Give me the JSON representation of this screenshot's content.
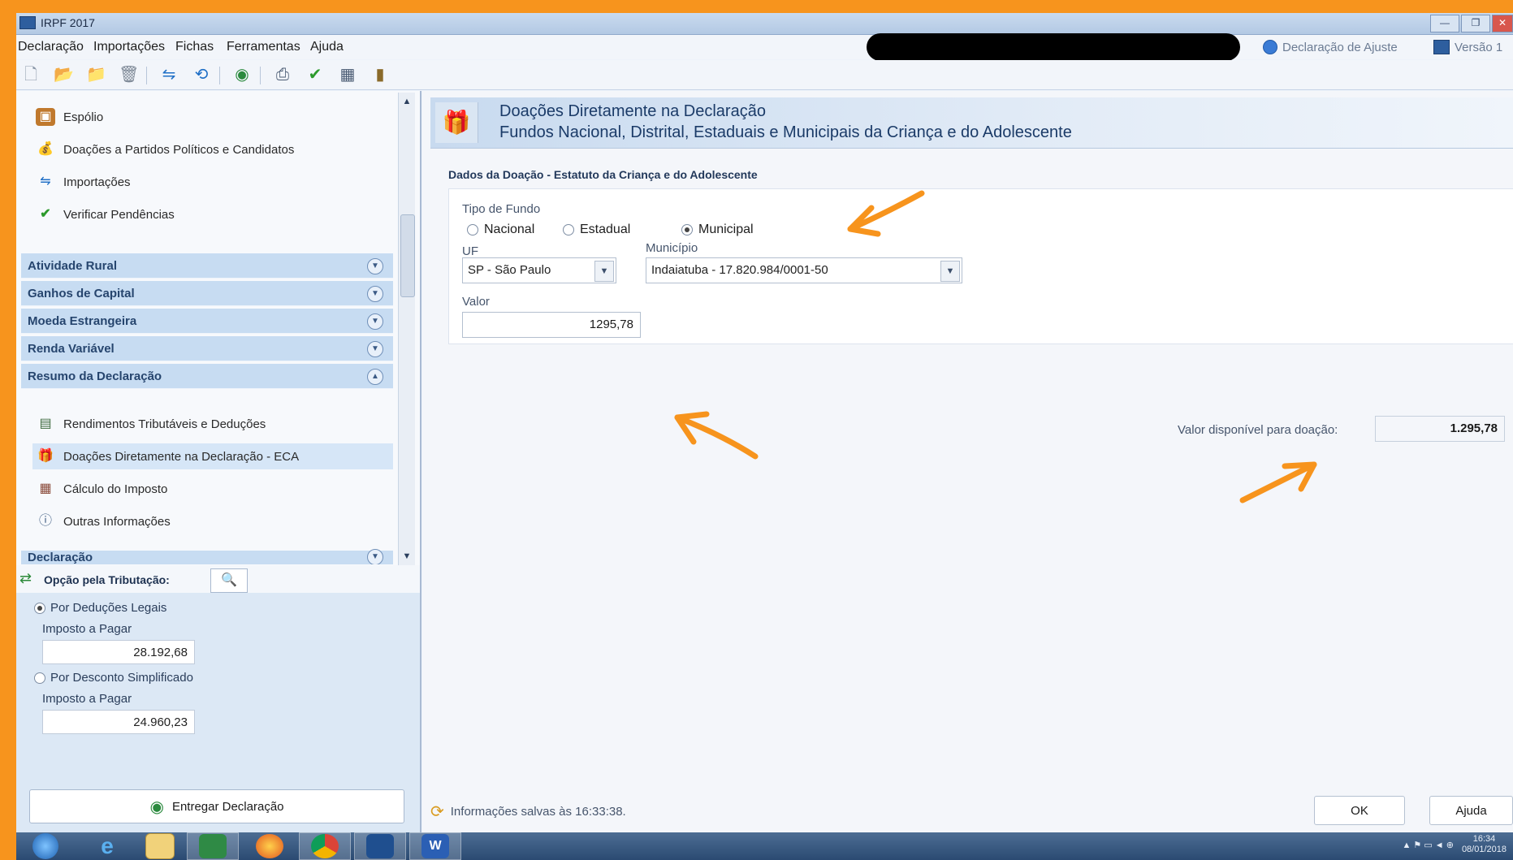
{
  "window": {
    "title": "IRPF 2017"
  },
  "menu": [
    "Declaração",
    "Importações",
    "Fichas",
    "Ferramentas",
    "Ajuda"
  ],
  "header_right": {
    "declaracao_ajuste": "Declaração de Ajuste",
    "versao": "Versão 1"
  },
  "sidebar": {
    "items_top": [
      {
        "label": "Espólio",
        "icon": "chest-icon"
      },
      {
        "label": "Doações a Partidos Políticos e Candidatos",
        "icon": "donation-bag-icon"
      },
      {
        "label": "Importações",
        "icon": "import-icon"
      },
      {
        "label": "Verificar Pendências",
        "icon": "checkmark-icon"
      }
    ],
    "sections": [
      "Atividade Rural",
      "Ganhos de Capital",
      "Moeda Estrangeira",
      "Renda Variável",
      "Resumo da Declaração"
    ],
    "resumo_items": [
      {
        "label": "Rendimentos Tributáveis e Deduções",
        "icon": "document-icon"
      },
      {
        "label": "Doações Diretamente na Declaração - ECA",
        "icon": "donation-icon"
      },
      {
        "label": "Cálculo do Imposto",
        "icon": "calculator-icon"
      },
      {
        "label": "Outras Informações",
        "icon": "info-icon"
      }
    ],
    "last_section": "Declaração"
  },
  "opcao": {
    "title": "Opção pela Tributação:",
    "deducoes_legais": "Por Deduções Legais",
    "imposto_label_1": "Imposto a Pagar",
    "imposto_value_1": "28.192,68",
    "desconto_simplificado": "Por Desconto Simplificado",
    "imposto_label_2": "Imposto a Pagar",
    "imposto_value_2": "24.960,23",
    "entregar": "Entregar Declaração"
  },
  "main": {
    "banner_title": "Doações Diretamente na Declaração",
    "banner_subtitle": "Fundos Nacional, Distrital, Estaduais e Municipais da Criança e do Adolescente",
    "section_title": "Dados da Doação - Estatuto da Criança e do Adolescente",
    "tipo_fundo_label": "Tipo de Fundo",
    "tipo_options": [
      "Nacional",
      "Estadual",
      "Municipal"
    ],
    "tipo_selected": "Municipal",
    "uf_label": "UF",
    "uf_value": "SP - São Paulo",
    "municipio_label": "Município",
    "municipio_value": "Indaiatuba - 17.820.984/0001-50",
    "valor_label": "Valor",
    "valor_value": "1295,78",
    "disponivel_label": "Valor disponível para doação:",
    "disponivel_value": "1.295,78",
    "info_saved": "Informações salvas às 16:33:38.",
    "ok_label": "OK",
    "ajuda_label": "Ajuda"
  },
  "taskbar": {
    "time": "16:34",
    "date": "08/01/2018"
  },
  "colors": {
    "frame": "#f7941d",
    "section_bg": "#c7dcf2",
    "accent_blue": "#1b3b68"
  }
}
